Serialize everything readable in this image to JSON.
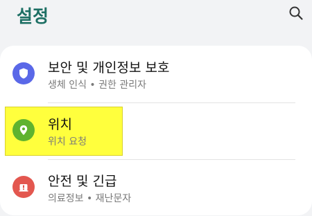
{
  "header": {
    "title": "설정",
    "search_icon": "search-icon"
  },
  "items": [
    {
      "title": "보안 및 개인정보 보호",
      "subtitle": "생체 인식 • 권한 관리자",
      "icon": "shield-icon",
      "color": "#5a68e8"
    },
    {
      "title": "위치",
      "subtitle": "위치 요청",
      "icon": "location-pin-icon",
      "color": "#5fb32f"
    },
    {
      "title": "안전 및 긴급",
      "subtitle": "의료정보 • 재난문자",
      "icon": "alert-icon",
      "color": "#e3574f"
    }
  ],
  "colors": {
    "title": "#1d6f64",
    "highlight": "#ffff3d"
  }
}
